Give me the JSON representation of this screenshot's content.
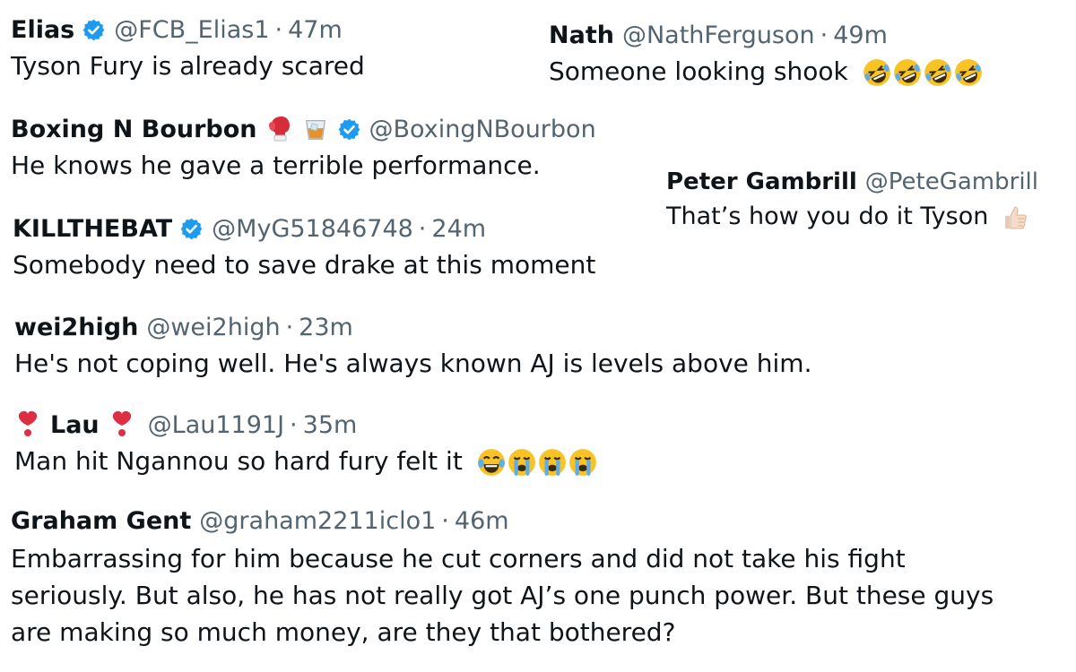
{
  "tweets": [
    {
      "name": "Elias",
      "handle": "@FCB_Elias1",
      "time": "47m",
      "text": "Tyson Fury is already scared"
    },
    {
      "name": "Nath",
      "handle": "@NathFerguson",
      "time": "49m",
      "text": "Someone looking shook",
      "emojis": [
        "rolling-on-floor-laughing",
        "rolling-on-floor-laughing",
        "rolling-on-floor-laughing",
        "rolling-on-floor-laughing"
      ]
    },
    {
      "name": "Boxing N Bourbon",
      "handle": "@BoxingNBourbon",
      "text": "He knows he gave a terrible performance.",
      "emojis": [
        "boxing-glove",
        "tumbler-glass"
      ]
    },
    {
      "name": "Peter Gambrill",
      "handle": "@PeteGambrill",
      "text": "That’s how you do it Tyson",
      "emojis": [
        "thumbs-up"
      ]
    },
    {
      "name": "KILLTHEBAT",
      "handle": "@MyG51846748",
      "time": "24m",
      "text": "Somebody need to save drake at this moment"
    },
    {
      "name": "wei2high",
      "handle": "@wei2high",
      "time": "23m",
      "text": "He's not coping well. He's always known AJ is levels above him."
    },
    {
      "name": "Lau",
      "handle": "@Lau1191J",
      "time": "35m",
      "text": "Man hit Ngannou so hard fury felt it",
      "emojis": [
        "heavy-exclamation-mark",
        "heavy-exclamation-mark",
        "face-with-tears-of-joy",
        "loudly-crying-face",
        "loudly-crying-face",
        "loudly-crying-face"
      ]
    },
    {
      "name": "Graham Gent",
      "handle": "@graham2211iclo1",
      "time": "46m",
      "text": "Embarrassing for him because he cut corners and did not take his fight seriously. But also, he has not really got AJ’s one punch power. But these guys are making so much money, are they that bothered?"
    }
  ],
  "separator": "·",
  "colors": {
    "name": "#0f1419",
    "handle": "#536471",
    "verified": "#1d9bf0"
  }
}
